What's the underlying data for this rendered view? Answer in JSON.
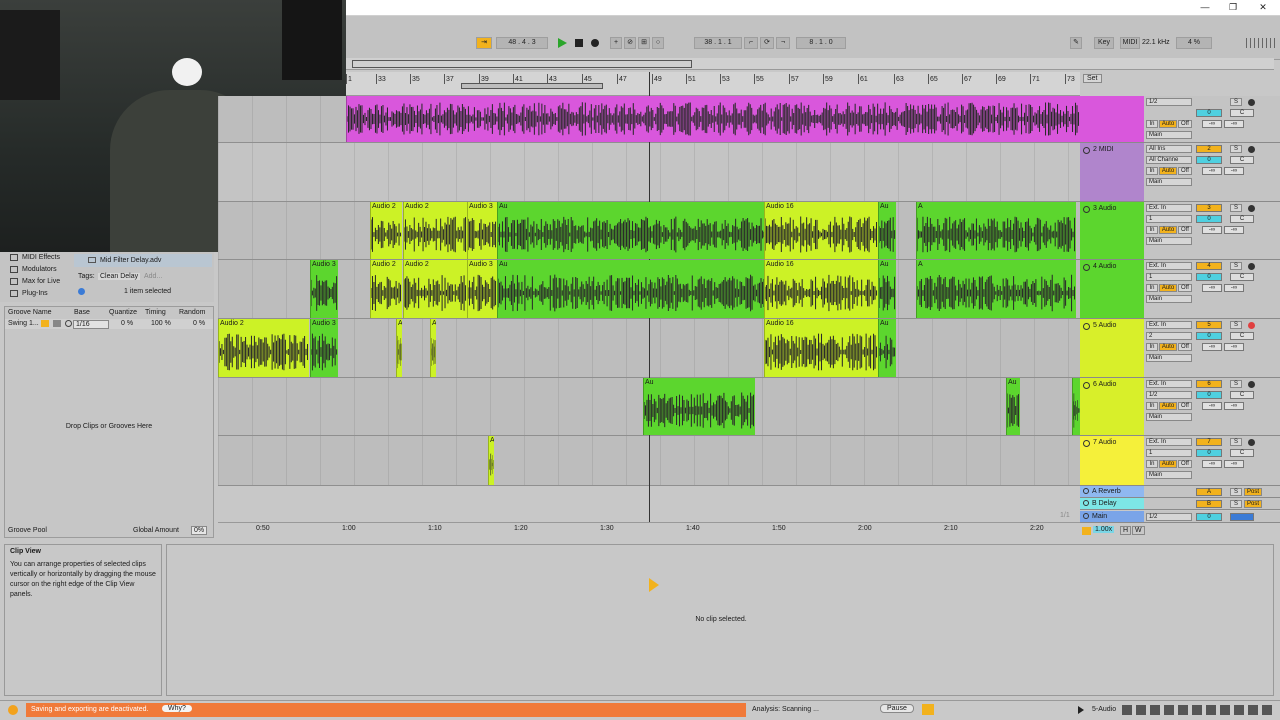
{
  "window": {
    "minimize": "—",
    "restore": "❐",
    "close": "✕"
  },
  "transport": {
    "arrangement_position": "48 .  4 .  3",
    "loop_start": "38 .  1 .  1",
    "loop_length": "8 .  1 .  0",
    "key_label": "Key",
    "midi_label": "MIDI",
    "sample_rate": "22.1 kHz",
    "cpu": "4 %"
  },
  "ruler": {
    "bars": [
      "1",
      "33",
      "35",
      "37",
      "39",
      "41",
      "43",
      "45",
      "47",
      "49",
      "51",
      "53",
      "55",
      "57",
      "59",
      "61",
      "63",
      "65",
      "67",
      "69",
      "71",
      "73"
    ],
    "set_label": "Set",
    "times": [
      "0:50",
      "1:00",
      "1:10",
      "1:20",
      "1:30",
      "1:40",
      "1:50",
      "2:00",
      "2:10",
      "2:20"
    ]
  },
  "browser": {
    "items": [
      {
        "icon": "midi-effects-icon",
        "label": "MIDI Effects"
      },
      {
        "icon": "modulators-icon",
        "label": "Modulators"
      },
      {
        "icon": "max-for-live-icon",
        "label": "Max for Live"
      },
      {
        "icon": "plugins-icon",
        "label": "Plug-Ins"
      }
    ],
    "file_name": "Mid Filter Delay.adv",
    "tags_label": "Tags:",
    "tag_value": "Clean Delay",
    "tag_add": "Add...",
    "selection_info": "1 item selected"
  },
  "groove": {
    "headers": [
      "Groove Name",
      "Base",
      "Quantize",
      "Timing",
      "Random"
    ],
    "row": {
      "name": "Swing 1...",
      "base": "1/16",
      "quantize": "0 %",
      "timing": "100 %",
      "random": "0 %"
    },
    "drop_hint": "Drop Clips or Grooves Here",
    "pool_label": "Groove Pool",
    "global_amount_label": "Global Amount",
    "global_amount_value": "0%"
  },
  "tracks": [
    {
      "name": "",
      "color": "#d957dc",
      "number": "",
      "input_type": "1/2",
      "input_channel": "",
      "output": "Main",
      "vol": "-∞",
      "pan": "C"
    },
    {
      "name": "2 MIDI",
      "color": "#b085cc",
      "number": "2",
      "input_type": "All Ins",
      "input_channel": "All Channe",
      "output": "Main",
      "vol": "-∞",
      "pan": "C"
    },
    {
      "name": "3 Audio",
      "color": "#5cd62e",
      "number": "3",
      "input_type": "Ext. In",
      "input_channel": "1",
      "output": "Main",
      "vol": "-∞",
      "pan": "C"
    },
    {
      "name": "4 Audio",
      "color": "#5cd62e",
      "number": "4",
      "input_type": "Ext. In",
      "input_channel": "1",
      "output": "Main",
      "vol": "-∞",
      "pan": "C"
    },
    {
      "name": "5 Audio",
      "color": "#d8ef2a",
      "number": "5",
      "input_type": "Ext. In",
      "input_channel": "2",
      "output": "Main",
      "vol": "-∞",
      "pan": "C"
    },
    {
      "name": "6 Audio",
      "color": "#d8ef2a",
      "number": "6",
      "input_type": "Ext. In",
      "input_channel": "1/2",
      "output": "Main",
      "vol": "-∞",
      "pan": "C"
    },
    {
      "name": "7 Audio",
      "color": "#f5f03a",
      "number": "7",
      "input_type": "Ext. In",
      "input_channel": "1",
      "output": "Main",
      "vol": "-∞",
      "pan": "C"
    }
  ],
  "returns": [
    {
      "name": "A Reverb",
      "letter": "A",
      "color": "#8fb8f0"
    },
    {
      "name": "B Delay",
      "color": "#7de6e6",
      "letter": "B"
    },
    {
      "name": "Main",
      "color": "#7aa4e8",
      "letter": "",
      "input": "1/2",
      "vol": "0"
    }
  ],
  "mixer_labels": {
    "in": "In",
    "auto": "Auto",
    "off": "Off",
    "solo": "S",
    "post": "Post",
    "zero": "0"
  },
  "clip_labels": {
    "a2": "Audio 2",
    "a3": "Audio 3",
    "a16": "Audio 16",
    "au": "Au",
    "a": "A"
  },
  "tempo_footer": {
    "zoom": "1/1",
    "rate": "1.00x",
    "h": "H",
    "w": "W"
  },
  "clip_view": {
    "title": "Clip View",
    "help": "You can arrange properties of selected clips vertically or horizontally by dragging the mouse cursor on the right edge of the Clip View panels.",
    "empty": "No clip selected."
  },
  "status": {
    "warning": "Saving and exporting are deactivated.",
    "why": "Why?",
    "analysis": "Analysis: Scanning ...",
    "pause": "Pause",
    "selected_track": "5-Audio"
  }
}
